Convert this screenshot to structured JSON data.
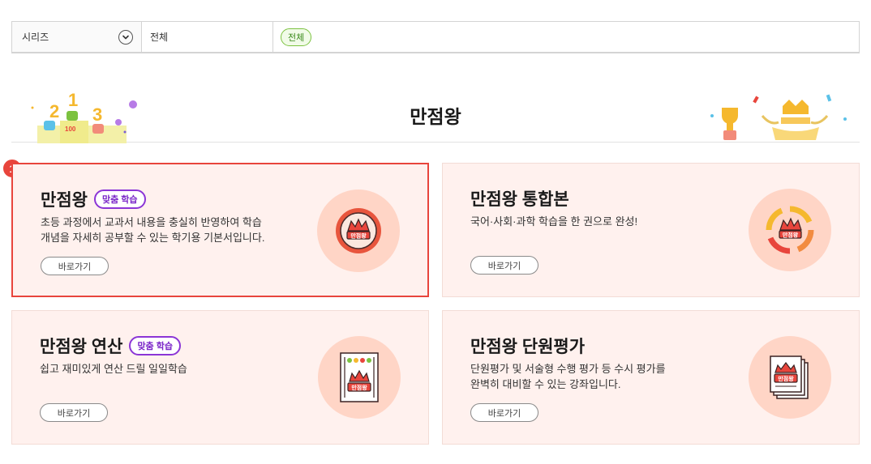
{
  "filter": {
    "series_label": "시리즈",
    "category_label": "전체",
    "selected_tag": "전체"
  },
  "banner": {
    "title": "만점왕",
    "left_number": "100"
  },
  "highlight_number": "1",
  "icon_logo_text": "만점왕",
  "cards": [
    {
      "title": "만점왕",
      "badge": "맞춤 학습",
      "desc_lines": [
        "초등 과정에서 교과서 내용을 충실히 반영하여 학습",
        "개념을 자세히 공부할 수 있는 학기용 기본서입니다."
      ],
      "button": "바로가기",
      "icon": "crown-badge-icon"
    },
    {
      "title": "만점왕 통합본",
      "badge": "",
      "desc_lines": [
        "국어·사회·과학 학습을 한 권으로 완성!"
      ],
      "button": "바로가기",
      "icon": "crown-cycle-icon"
    },
    {
      "title": "만점왕 연산",
      "badge": "맞춤 학습",
      "desc_lines": [
        "쉽고 재미있게 연산 드릴 일일학습"
      ],
      "button": "바로가기",
      "icon": "crown-abacus-icon"
    },
    {
      "title": "만점왕 단원평가",
      "badge": "",
      "desc_lines": [
        "단원평가 및 서술형 수행 평가 등 수시 평가를",
        "완벽히 대비할 수 있는 강좌입니다."
      ],
      "button": "바로가기",
      "icon": "crown-papers-icon"
    }
  ],
  "colors": {
    "highlight": "#e8453c",
    "badge_purple": "#8b35d6",
    "card_bg": "#fff1ee",
    "icon_circle": "#ffd5c6",
    "tag_green": "#7cc240"
  }
}
